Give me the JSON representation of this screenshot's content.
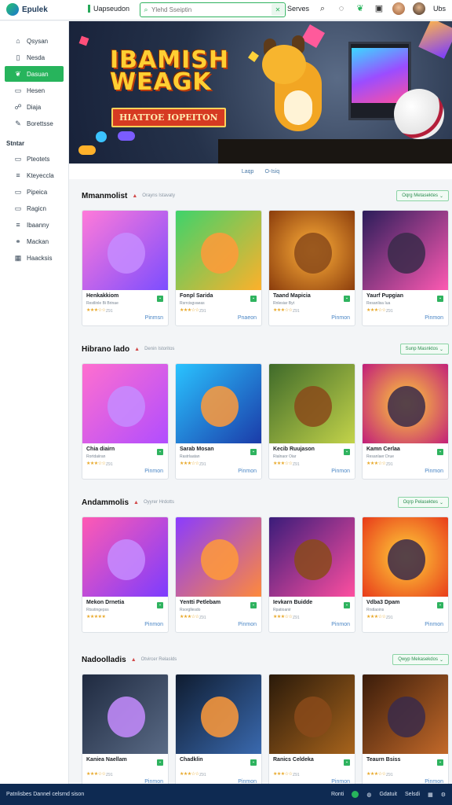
{
  "header": {
    "logo_text": "Epulek",
    "app_title": "Uapseudon",
    "search_placeholder": "Ylehd Sseiptin",
    "right_label": "Serves",
    "right_last": "Ubs"
  },
  "sidebar": {
    "items": [
      {
        "label": "Qsysan",
        "icon": "home-icon"
      },
      {
        "label": "Nesda",
        "icon": "bookmark-icon"
      },
      {
        "label": "Dasuan",
        "icon": "leaf-icon",
        "active": true
      },
      {
        "label": "Hesen",
        "icon": "page-icon"
      },
      {
        "label": "Diaja",
        "icon": "users-icon"
      },
      {
        "label": "Borettsse",
        "icon": "pen-icon"
      }
    ],
    "section_title": "Stntar",
    "sub_items": [
      {
        "label": "Pteotets",
        "icon": "doc-icon"
      },
      {
        "label": "Kteyeccla",
        "icon": "list-icon"
      },
      {
        "label": "Pipeica",
        "icon": "doc-icon"
      },
      {
        "label": "Ragicn",
        "icon": "doc-icon"
      },
      {
        "label": "Ibaanny",
        "icon": "list-icon"
      },
      {
        "label": "Mackan",
        "icon": "link-icon"
      },
      {
        "label": "Haacksis",
        "icon": "grid-icon"
      }
    ]
  },
  "hero": {
    "title_line1": "IBAMISH",
    "title_line2": "WEAGK",
    "subtitle": "HIATTOE IOPEITON"
  },
  "tabs": {
    "left": "Laqp",
    "right": "O-Isiq"
  },
  "sections": [
    {
      "title": "Mmanmolist",
      "subtitle": "Orayns Istavaty",
      "button": "Oqrg Metasektes",
      "cards": [
        {
          "title": "Henkakkiom",
          "sub": "Restlinle Bi Brinae",
          "stars": "★★★☆☆",
          "count": "Z91",
          "link": "Pinmsn"
        },
        {
          "title": "Fonpl Sarida",
          "sub": "Rsrrcisgvaeas",
          "stars": "★★★☆☆",
          "count": "Z91",
          "link": "Pnaeon"
        },
        {
          "title": "Taand Mapicia",
          "sub": "Rnlesiar Byt",
          "stars": "★★★☆☆",
          "count": "Z91",
          "link": "Pinmon"
        },
        {
          "title": "Yaurf Pupgian",
          "sub": "Resanlisa Iua",
          "stars": "★★★☆☆",
          "count": "Z91",
          "link": "Pinmon"
        }
      ]
    },
    {
      "title": "Hibrano lado",
      "subtitle": "Denin Istoritos",
      "button": "Sunp Masnktos",
      "cards": [
        {
          "title": "Chia diairn",
          "sub": "Rortdaiiran",
          "stars": "★★★☆☆",
          "count": "Z91",
          "link": "Pinmon"
        },
        {
          "title": "Sarab Mosan",
          "sub": "Rastrlaatan",
          "stars": "★★★☆☆",
          "count": "Z91",
          "link": "Pinmon"
        },
        {
          "title": "Kecib Ruujason",
          "sub": "Rialnaor Oiar",
          "stars": "★★★☆☆",
          "count": "Z91",
          "link": "Pinmon"
        },
        {
          "title": "Kamn Cerlaa",
          "sub": "Resanlaer Drue",
          "stars": "★★★☆☆",
          "count": "Z91",
          "link": "Pinmon"
        }
      ]
    },
    {
      "title": "Andammolis",
      "subtitle": "Oyyrer Hrdotts",
      "button": "Oqrp Pelasektes",
      "cards": [
        {
          "title": "Mekon Drnetia",
          "sub": "Rtsstingepss",
          "stars": "★★★★★",
          "count": "",
          "link": "Pinmon"
        },
        {
          "title": "Yentti Petlebam",
          "sub": "Rsorgllesdo",
          "stars": "★★★☆☆",
          "count": "Z91",
          "link": "Pinmon"
        },
        {
          "title": "Ievkarn Buidde",
          "sub": "Rpatioanir",
          "stars": "★★★☆☆",
          "count": "Z91",
          "link": "Pinmon"
        },
        {
          "title": "Vdba3 Dpam",
          "sub": "Rrstlaoins",
          "stars": "★★★☆☆",
          "count": "Z91",
          "link": "Pinmon"
        }
      ]
    },
    {
      "title": "Nadoolladis",
      "subtitle": "Otvircer Relaslds",
      "button": "Qwyp Mekasekdos",
      "cards": [
        {
          "title": "Kaniea Naellam",
          "sub": "",
          "stars": "★★★☆☆",
          "count": "Z91",
          "link": "Pinmon"
        },
        {
          "title": "Chadklin",
          "sub": "",
          "stars": "★★★☆☆",
          "count": "Z91",
          "link": "Pinmon"
        },
        {
          "title": "Ranics Celdeka",
          "sub": "",
          "stars": "★★★☆☆",
          "count": "Z91",
          "link": "Pinmon"
        },
        {
          "title": "Teaurn Bsiss",
          "sub": "",
          "stars": "★★★☆☆",
          "count": "Z91",
          "link": "Pinmon"
        }
      ]
    }
  ],
  "footer": {
    "left": "Patnlisbes Dannel celsrnd sison",
    "items": [
      "Ronti",
      "Gdatuit",
      "Selsdi"
    ]
  }
}
